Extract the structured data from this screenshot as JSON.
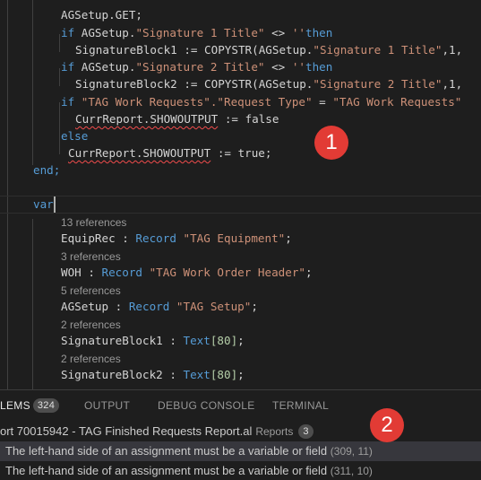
{
  "editor": {
    "code": {
      "l1": "AGSetup.GET;",
      "l2_if": "if",
      "l2_a": "AGSetup.",
      "l2_str": "\"Signature 1 Title\"",
      "l2_b": " <> ",
      "l2_c": "''",
      "l2_then": "then",
      "l3": "SignatureBlock1 := COPYSTR(AGSetup.",
      "l3_str": "\"Signature 1 Title\"",
      "l3_end": ",1,",
      "l4_if": "if",
      "l4_a": "AGSetup.",
      "l4_str": "\"Signature 2 Title\"",
      "l4_b": " <> ",
      "l4_c": "''",
      "l4_then": "then",
      "l5": "SignatureBlock2 := COPYSTR(AGSetup.",
      "l5_str": "\"Signature 2 Title\"",
      "l5_end": ",1,",
      "l6_if": "if",
      "l6_a": "\"TAG Work Requests\".",
      "l6_str": "\"Request Type\"",
      "l6_b": " = ",
      "l6_c": "\"TAG Work Requests\"",
      "l7_a": "CurrReport.SHOWOUTPUT",
      "l7_b": " := false",
      "l8": "else",
      "l9_a": "CurrReport.SHOWOUTPUT",
      "l9_b": " := true;",
      "l10": "end;",
      "l11": "var"
    },
    "vars": [
      {
        "refs": "13 references",
        "name": "EquipRec",
        "type": "Record",
        "target": "\"TAG Equipment\"",
        "end": ";"
      },
      {
        "refs": "3 references",
        "name": "WOH",
        "type": "Record",
        "target": "\"TAG Work Order Header\"",
        "end": ";"
      },
      {
        "refs": "5 references",
        "name": "AGSetup",
        "type": "Record",
        "target": "\"TAG Setup\"",
        "end": ";"
      },
      {
        "refs": "2 references",
        "name": "SignatureBlock1",
        "type": "Text",
        "target": "[80]",
        "end": ";"
      },
      {
        "refs": "2 references",
        "name": "SignatureBlock2",
        "type": "Text",
        "target": "[80]",
        "end": ";"
      }
    ],
    "callout_1": "1"
  },
  "panel": {
    "tabs": {
      "problems": "LEMS",
      "problems_count": "324",
      "output": "OUTPUT",
      "debug": "DEBUG CONSOLE",
      "terminal": "TERMINAL"
    },
    "file": {
      "name": "ort 70015942 - TAG Finished Requests Report.al",
      "folder": "Reports",
      "count": "3"
    },
    "problems": [
      {
        "message": "The left-hand side of an assignment must be a variable or field",
        "location": "(309, 11)"
      },
      {
        "message": "The left-hand side of an assignment must be a variable or field",
        "location": "(311, 10)"
      }
    ],
    "callout_2": "2"
  },
  "colors": {
    "background": "#1e1e1e",
    "keyword": "#569cd6",
    "string": "#ce9178",
    "type": "#4ec9b0",
    "callout": "#e23b35"
  }
}
